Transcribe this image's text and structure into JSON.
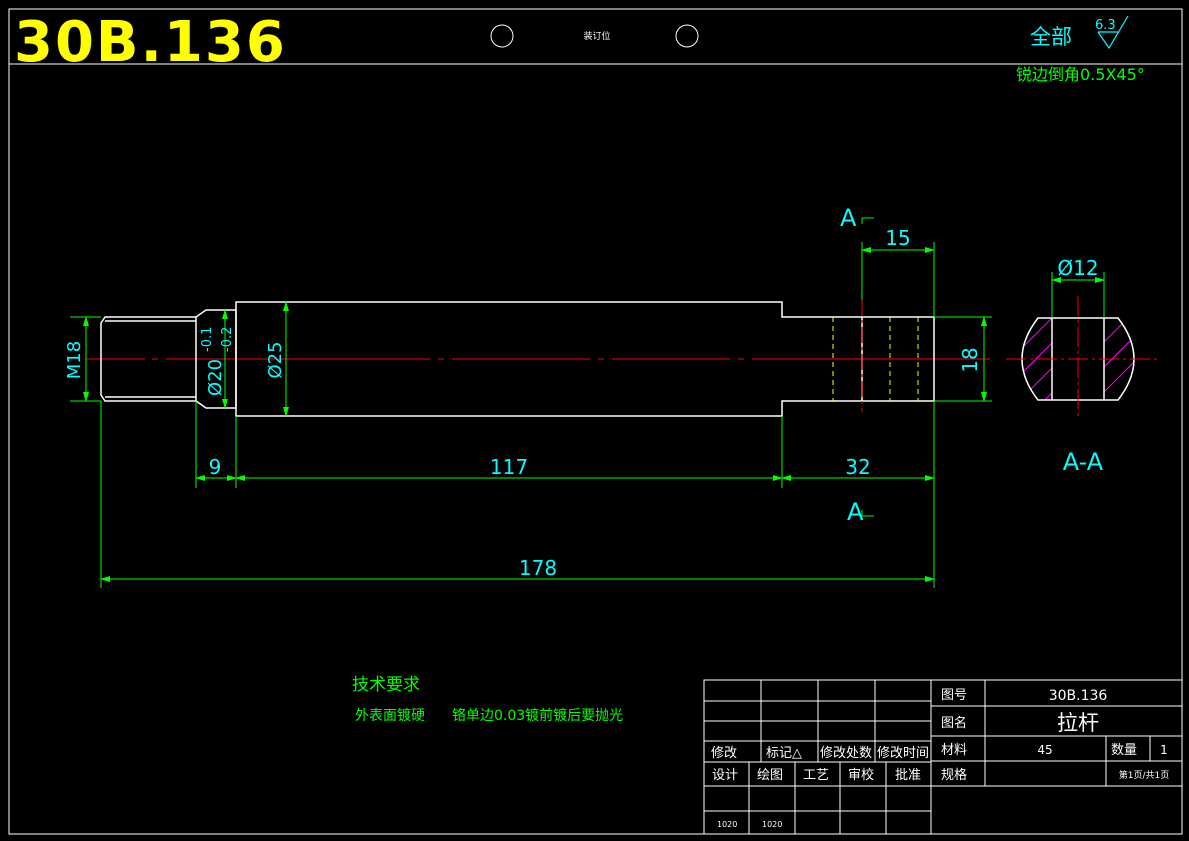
{
  "header": {
    "drawing_code": "30B.136",
    "binding_label": "装订位",
    "roughness_prefix": "全部",
    "roughness_value": "6.3",
    "chamfer_note": "锐边倒角0.5X45°"
  },
  "dimensions": {
    "m18": "M18",
    "d20": "Ø20",
    "d20_tol_upper": "-0.1",
    "d20_tol_lower": "-0.2",
    "d25": "Ø25",
    "d9": "9",
    "d117": "117",
    "d32": "32",
    "d178": "178",
    "d15": "15",
    "d18": "18",
    "d12": "Ø12"
  },
  "section": {
    "cut_letter_top": "A",
    "cut_letter_bottom": "A",
    "view_label": "A-A"
  },
  "tech": {
    "title": "技术要求",
    "line_part1": "外表面镀硬",
    "line_part2": "铬单边0.03镀前镀后要抛光"
  },
  "title_block": {
    "rev_headers": [
      "修改",
      "标记△",
      "修改处数",
      "修改时间"
    ],
    "sign_headers": [
      "设计",
      "绘图",
      "工艺",
      "审校",
      "批准"
    ],
    "sign_values": [
      "1020",
      "1020",
      "",
      "",
      ""
    ],
    "drawing_no_label": "图号",
    "drawing_no": "30B.136",
    "name_label": "图名",
    "name": "拉杆",
    "material_label": "材料",
    "material": "45",
    "qty_label": "数量",
    "qty": "1",
    "spec_label": "规格",
    "spec": "",
    "page": "第1页/共1页"
  },
  "colors": {
    "background": "#000000",
    "outline": "#ffffff",
    "dimension": "#00ff00",
    "dim_text": "#00ffff",
    "centerline": "#ff0000",
    "title_yellow": "#ffff00",
    "hidden_line": "#ffff00",
    "hatch": "#ff00ff"
  }
}
